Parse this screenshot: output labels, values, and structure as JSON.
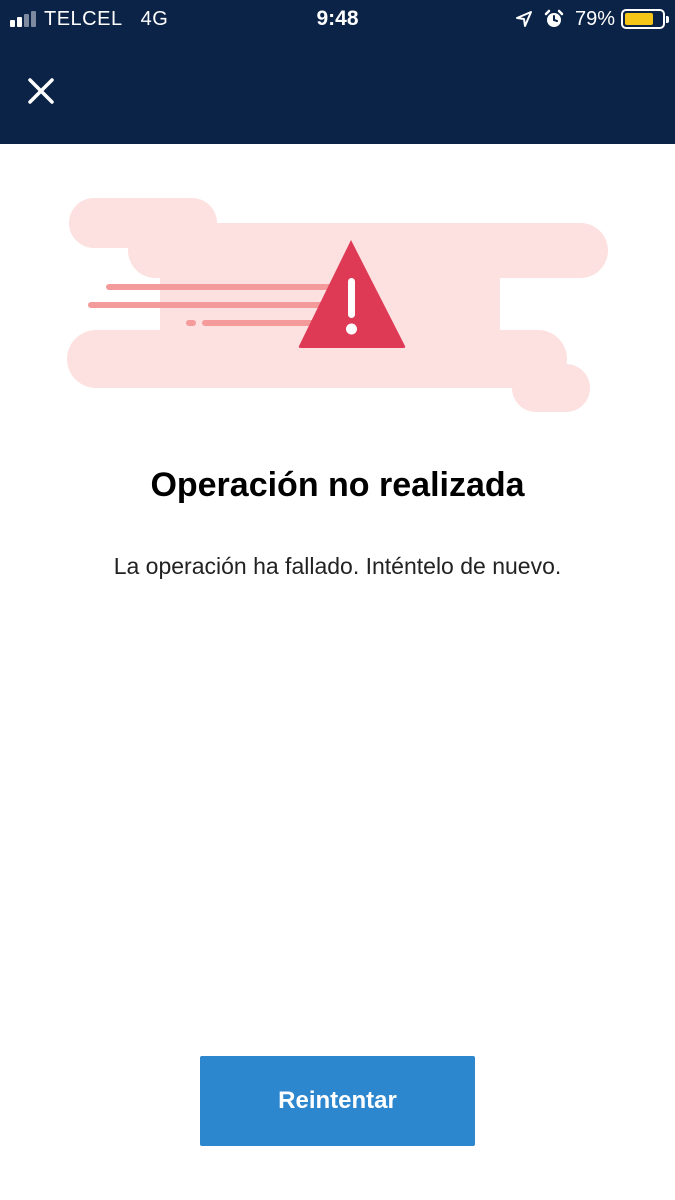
{
  "status_bar": {
    "carrier": "TELCEL",
    "network": "4G",
    "time": "9:48",
    "battery_percent": "79%",
    "battery_level": 0.79,
    "signal_bars_active": 2,
    "signal_bars_total": 4,
    "icons": [
      "signal-icon",
      "location-arrow-icon",
      "alarm-icon",
      "battery-icon"
    ]
  },
  "header": {
    "close_icon": "close-icon"
  },
  "illustration": {
    "icon": "warning-triangle-icon",
    "colors": {
      "cloud": "#fde0e0",
      "speed_lines": "#f59a9a",
      "triangle": "#de3a55"
    }
  },
  "main": {
    "title": "Operación no realizada",
    "message": "La operación ha fallado. Inténtelo de nuevo."
  },
  "actions": {
    "retry_label": "Reintentar"
  },
  "colors": {
    "header_bg": "#0b2347",
    "primary_button": "#2d87cf",
    "battery_fill": "#f5c518"
  }
}
